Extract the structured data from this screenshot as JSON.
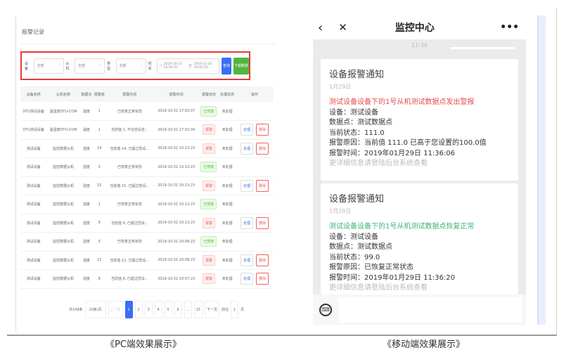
{
  "pc": {
    "title": "报警记录",
    "filters": [
      {
        "label": "设备",
        "value": "全部"
      },
      {
        "label": "从机",
        "value": "全部"
      },
      {
        "label": "类型",
        "value": "全部"
      }
    ],
    "time_label": "时间",
    "date_start": "2019-10-21 16:05:53",
    "date_sep": "至",
    "date_end": "2019-11-01 16:05:53",
    "query_label": "查询",
    "download_label": "下载数据",
    "columns": [
      "设备名称",
      "从机名称",
      "数据点",
      "报警值",
      "报警内容",
      "报警时间",
      "报警状态",
      "处理状态",
      "操作"
    ],
    "rows": [
      {
        "device": "DTU测试设备",
        "slave": "温湿度DTU-COM",
        "point": "温度",
        "value": "1",
        "content": "已恢复正常状态",
        "time": "2019-10-31 17:02:07",
        "status": "已恢复",
        "status_type": "ok",
        "handle": "未处理",
        "actions": false
      },
      {
        "device": "DTU测试设备",
        "slave": "温湿度DTU-COM",
        "point": "温度",
        "value": "1",
        "content": "当前值 1, 不在您设定...",
        "time": "2019-10-31 17:02:04",
        "status": "报警",
        "status_type": "al",
        "handle": "未处理",
        "actions": true
      },
      {
        "device": "测试设备",
        "slave": "监控数据从机",
        "point": "湿度",
        "value": "14",
        "content": "当前值 14, 已超过您设...",
        "time": "2019-10-31 10:13:23",
        "status": "报警",
        "status_type": "al",
        "handle": "未处理",
        "actions": true
      },
      {
        "device": "测试设备",
        "slave": "监控数据从机",
        "point": "湿度",
        "value": "3",
        "content": "已恢复正常状态",
        "time": "2019-10-31 10:13:23",
        "status": "已恢复",
        "status_type": "ok",
        "handle": "未处理",
        "actions": false
      },
      {
        "device": "测试设备",
        "slave": "监控数据从机",
        "point": "湿度",
        "value": "15",
        "content": "当前值 15, 已超过您设...",
        "time": "2019-10-31 10:13:23",
        "status": "报警",
        "status_type": "al",
        "handle": "未处理",
        "actions": true
      },
      {
        "device": "测试设备",
        "slave": "监控数据从机",
        "point": "湿度",
        "value": "1",
        "content": "已恢复正常状态",
        "time": "2019-10-31 10:13:23",
        "status": "已恢复",
        "status_type": "ok",
        "handle": "未处理",
        "actions": false
      },
      {
        "device": "测试设备",
        "slave": "监控数据从机",
        "point": "湿度",
        "value": "9",
        "content": "当前值 9, 已超过您设...",
        "time": "2019-10-31 10:13:23",
        "status": "报警",
        "status_type": "al",
        "handle": "未处理",
        "actions": true
      },
      {
        "device": "测试设备",
        "slave": "监控数据从机",
        "point": "湿度",
        "value": "3",
        "content": "已恢复正常状态",
        "time": "2019-10-31 10:08:23",
        "status": "已恢复",
        "status_type": "ok",
        "handle": "未处理",
        "actions": false
      },
      {
        "device": "测试设备",
        "slave": "监控数据从机",
        "point": "湿度",
        "value": "12",
        "content": "当前值 12, 已超过您设...",
        "time": "2019-10-31 10:08:23",
        "status": "报警",
        "status_type": "al",
        "handle": "未处理",
        "actions": true
      },
      {
        "device": "测试设备",
        "slave": "监控数据从机",
        "point": "湿度",
        "value": "8",
        "content": "当前值 8, 已超过您设...",
        "time": "2019-10-31 10:07:23",
        "status": "报警",
        "status_type": "al",
        "handle": "未处理",
        "actions": true
      }
    ],
    "action_handle": "处理",
    "action_delete": "删除",
    "pager": {
      "total": "共148条",
      "page_size": "10条/页",
      "prev": "上一页",
      "pages": [
        "1",
        "2",
        "3",
        "4",
        "5",
        "6",
        "...",
        "15"
      ],
      "current": "1",
      "next": "下一页",
      "goto": "前往",
      "goto_value": "1",
      "goto_unit": "页"
    }
  },
  "mobile": {
    "title": "监控中心",
    "time": "11:36",
    "cards": [
      {
        "title": "设备报警通知",
        "date": "1月29日",
        "headline": "测试设备设备下的1号从机测试数据点发出警报",
        "color": "#e94b4b",
        "lines": [
          "设备：测试设备",
          "数据点：测试数据点",
          "当前状态：111.0",
          "报警原因：当前值 111.0 已高于您设置的100.0值",
          "报警时间：2019年01月29日 11:36:06"
        ],
        "more": "更详细信息请登陆后台系统查看"
      },
      {
        "title": "设备报警通知",
        "date": "1月29日",
        "headline": "测试设备设备下的1号从机测试数据点恢复正常",
        "color": "#3bb57a",
        "lines": [
          "设备：测试设备",
          "数据点：测试数据点",
          "当前状态：99.0",
          "报警原因：已恢复正常状态",
          "报警时间：2019年01月29日 11:36:20"
        ],
        "more": "更详细信息请登陆后台系统查看"
      }
    ]
  },
  "captions": {
    "pc": "《PC端效果展示》",
    "mobile": "《移动端效果展示》"
  }
}
